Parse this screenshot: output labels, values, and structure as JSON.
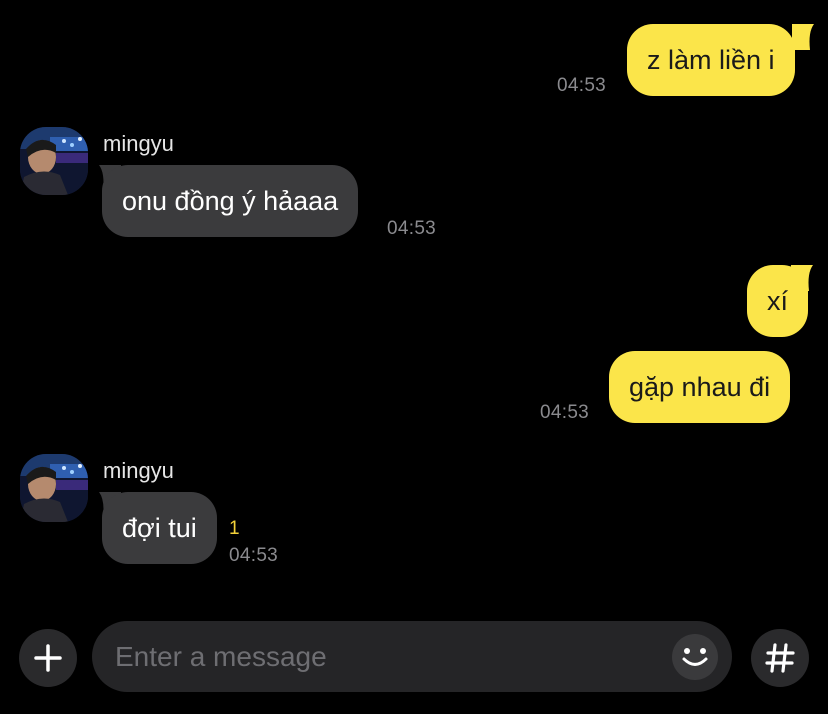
{
  "messages": [
    {
      "direction": "outgoing",
      "text": "z làm liền i",
      "time": "04:53"
    },
    {
      "direction": "incoming",
      "sender": "mingyu",
      "text": "onu đồng ý hảaaa",
      "time": "04:53"
    },
    {
      "direction": "outgoing",
      "text": "xí",
      "time": ""
    },
    {
      "direction": "outgoing",
      "text": "gặp nhau đi",
      "time": "04:53"
    },
    {
      "direction": "incoming",
      "sender": "mingyu",
      "text": "đợi tui",
      "time": "04:53",
      "unread_count": "1"
    }
  ],
  "composer": {
    "placeholder": "Enter a message",
    "add_icon": "plus-icon",
    "emoji_icon": "smiley-icon",
    "hashtag_icon": "hashtag-icon"
  },
  "colors": {
    "background": "#000000",
    "outgoing_bubble": "#fbe54a",
    "incoming_bubble": "#3b3b3d",
    "timestamp": "#8a8a8e",
    "unread_badge": "#f4d23a"
  }
}
